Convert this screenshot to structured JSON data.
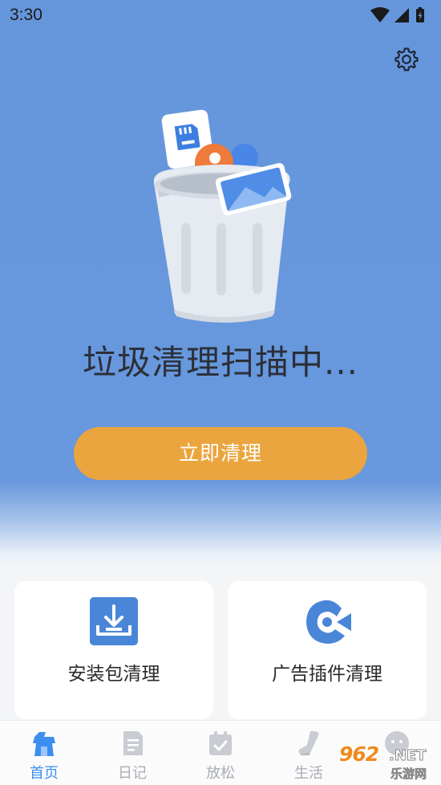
{
  "status_bar": {
    "time": "3:30",
    "icons": [
      "wifi-icon",
      "signal-icon",
      "battery-charging-icon"
    ]
  },
  "header": {
    "settings_icon": "gear-icon"
  },
  "scan": {
    "title": "垃圾清理扫描中..."
  },
  "actions": {
    "clean_now": "立即清理"
  },
  "tools": [
    {
      "label": "安装包清理",
      "icon": "download-tray-icon",
      "color": "#4a86d8"
    },
    {
      "label": "广告插件清理",
      "icon": "ad-blocker-icon",
      "color": "#4a86d8"
    }
  ],
  "tabs": [
    {
      "label": "首页",
      "icon": "home-icon",
      "active": true
    },
    {
      "label": "日记",
      "icon": "diary-icon",
      "active": false
    },
    {
      "label": "放松",
      "icon": "calendar-check-icon",
      "active": false
    },
    {
      "label": "生活",
      "icon": "shoe-icon",
      "active": false
    },
    {
      "label": "",
      "icon": "face-icon",
      "active": false
    }
  ],
  "watermark": {
    "number": "962",
    "domain": ".NET",
    "site": "乐游网"
  },
  "colors": {
    "hero_blue": "#6898dd",
    "button_orange": "#eba53e",
    "active_tab": "#3e8ef0"
  }
}
